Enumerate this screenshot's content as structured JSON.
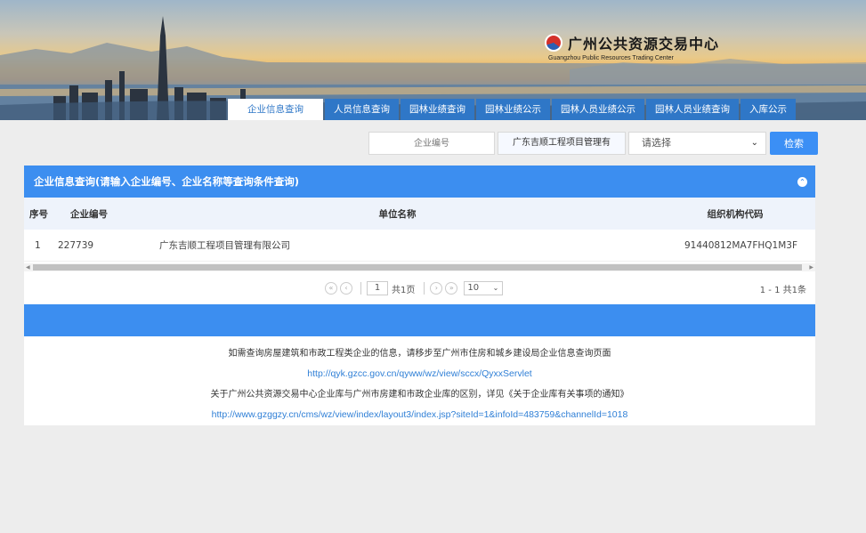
{
  "header": {
    "site_title": "广州公共资源交易中心",
    "site_subtitle": "Guangzhou Public Resources Trading Center"
  },
  "tabs": [
    {
      "label": "企业信息查询",
      "active": true
    },
    {
      "label": "人员信息查询"
    },
    {
      "label": "园林业绩查询"
    },
    {
      "label": "园林业绩公示"
    },
    {
      "label": "园林人员业绩公示"
    },
    {
      "label": "园林人员业绩查询"
    },
    {
      "label": "入库公示"
    }
  ],
  "search": {
    "code_placeholder": "企业编号",
    "name_value": "广东吉顺工程项目管理有",
    "select_value": "请选择",
    "button_label": "检索"
  },
  "panel": {
    "title": "企业信息查询(请输入企业编号、企业名称等查询条件查询)",
    "columns": [
      "序号",
      "企业编号",
      "单位名称",
      "组织机构代码"
    ],
    "rows": [
      [
        "1",
        "227739",
        "广东吉顺工程项目管理有限公司",
        "91440812MA7FHQ1M3F"
      ]
    ]
  },
  "pager": {
    "page_input": "1",
    "total_pages_text": "共1页",
    "page_size": "10",
    "summary": "1 - 1   共1条"
  },
  "notes": {
    "line1": "如需查询房屋建筑和市政工程类企业的信息，请移步至广州市住房和城乡建设局企业信息查询页面",
    "link1": "http://qyk.gzcc.gov.cn/qyww/wz/view/sccx/QyxxServlet",
    "line2": "关于广州公共资源交易中心企业库与广州市房建和市政企业库的区别，详见《关于企业库有关事项的通知》",
    "link2": "http://www.gzggzy.cn/cms/wz/view/index/layout3/index.jsp?siteId=1&infoId=483759&channelId=1018"
  },
  "colors": {
    "primary": "#3c8ef0",
    "tab": "#2f77c7",
    "link": "#2f7fd6"
  }
}
